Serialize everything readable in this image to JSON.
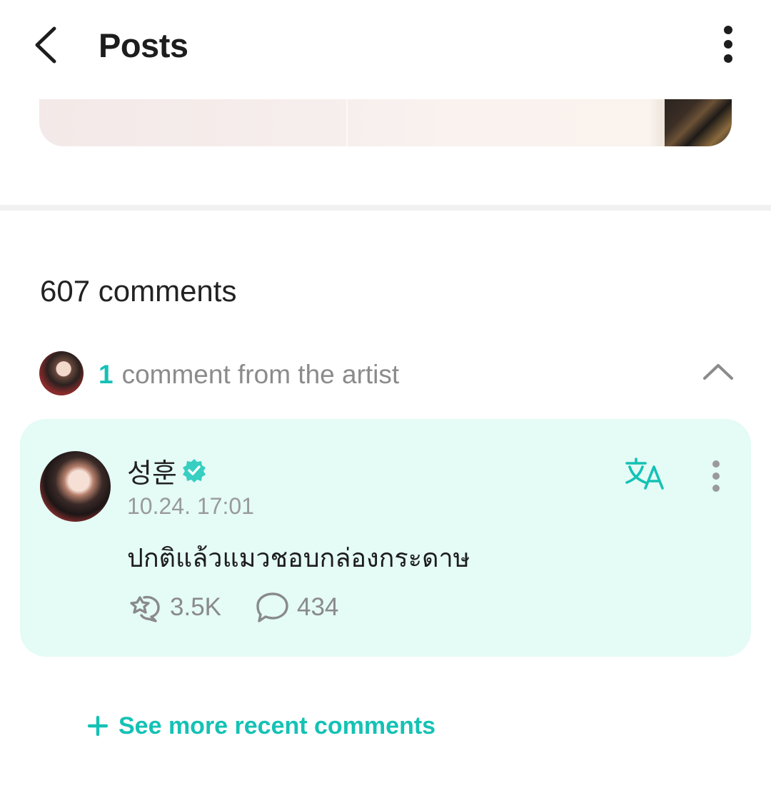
{
  "header": {
    "title": "Posts"
  },
  "comments": {
    "count_label": "607 comments"
  },
  "artist_summary": {
    "count": "1",
    "label": "comment from the artist"
  },
  "comment": {
    "author": "성훈",
    "timestamp": "10.24. 17:01",
    "body": "ปกติแล้วแมวชอบกล่องกระดาษ",
    "likes": "3.5K",
    "replies": "434"
  },
  "see_more": {
    "label": "See more recent comments"
  },
  "colors": {
    "accent": "#14c2b5",
    "card_bg": "#e4fbf6",
    "muted": "#8b8b8b"
  },
  "icons": [
    "back-arrow-icon",
    "more-vertical-icon",
    "chevron-up-icon",
    "verified-badge-icon",
    "translate-icon",
    "reaction-icon",
    "comment-bubble-icon",
    "plus-icon"
  ]
}
